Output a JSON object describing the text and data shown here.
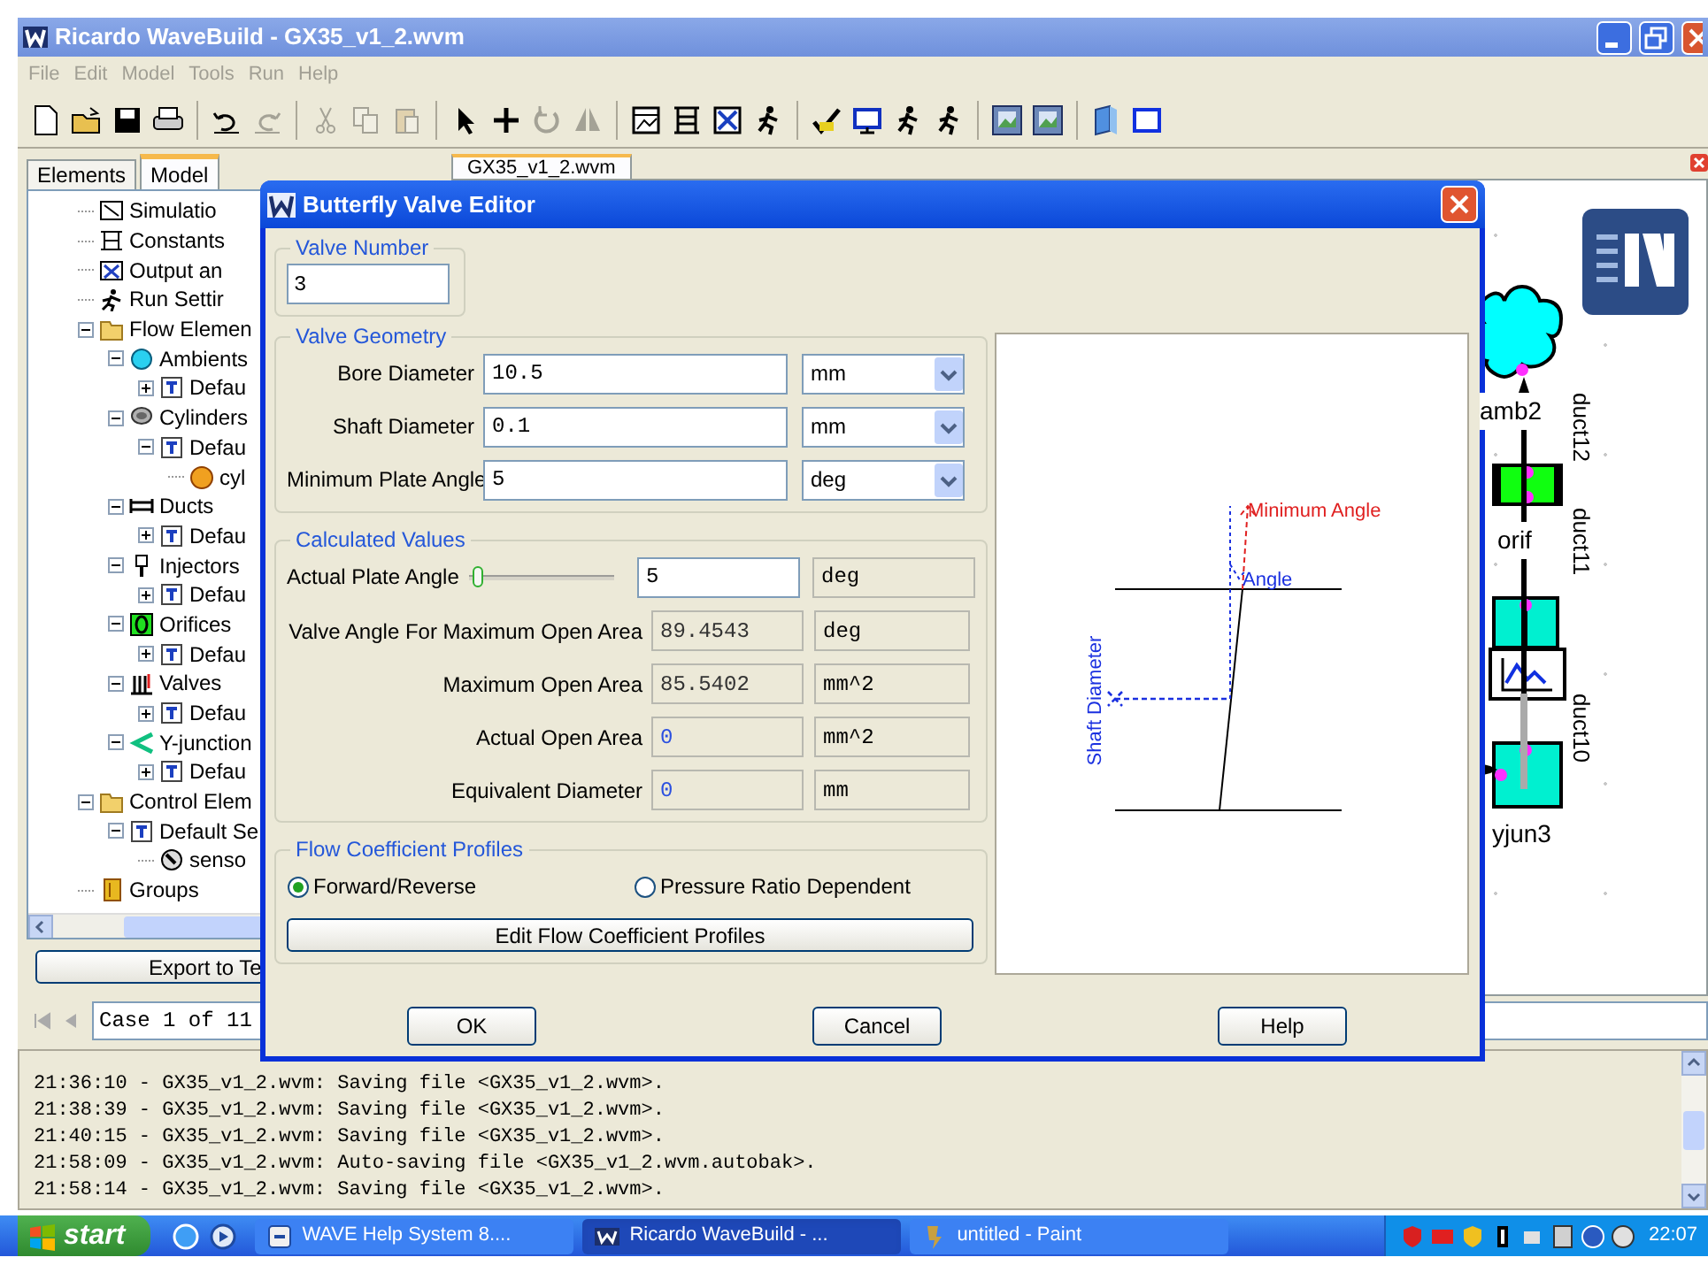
{
  "window": {
    "title": "Ricardo WaveBuild - GX35_v1_2.wvm"
  },
  "menu": [
    "File",
    "Edit",
    "Model",
    "Tools",
    "Run",
    "Help"
  ],
  "toolbar": [
    {
      "kind": "new",
      "disabled": false
    },
    {
      "kind": "open",
      "disabled": false
    },
    {
      "kind": "save",
      "disabled": false
    },
    {
      "kind": "print",
      "disabled": false
    },
    {
      "kind": "sep"
    },
    {
      "kind": "undo",
      "disabled": false
    },
    {
      "kind": "redo",
      "disabled": true
    },
    {
      "kind": "sep"
    },
    {
      "kind": "cut",
      "disabled": true
    },
    {
      "kind": "copy",
      "disabled": true
    },
    {
      "kind": "paste",
      "disabled": true
    },
    {
      "kind": "sep"
    },
    {
      "kind": "pointer",
      "disabled": false
    },
    {
      "kind": "plus",
      "disabled": false
    },
    {
      "kind": "rotate",
      "disabled": true
    },
    {
      "kind": "mirror",
      "disabled": true
    },
    {
      "kind": "sep"
    },
    {
      "kind": "window",
      "disabled": false
    },
    {
      "kind": "table",
      "disabled": false
    },
    {
      "kind": "chart",
      "disabled": false
    },
    {
      "kind": "runner",
      "disabled": false
    },
    {
      "kind": "sep"
    },
    {
      "kind": "check",
      "disabled": false
    },
    {
      "kind": "monitor",
      "disabled": false
    },
    {
      "kind": "runner",
      "disabled": false
    },
    {
      "kind": "runner",
      "disabled": false
    },
    {
      "kind": "sep"
    },
    {
      "kind": "image",
      "disabled": false
    },
    {
      "kind": "image",
      "disabled": false
    },
    {
      "kind": "sep"
    },
    {
      "kind": "book",
      "disabled": false
    },
    {
      "kind": "frame",
      "disabled": false
    }
  ],
  "left_panel": {
    "tabs": [
      {
        "label": "Elements",
        "selected": false
      },
      {
        "label": "Model",
        "selected": true
      }
    ],
    "tree": [
      {
        "label": "Simulatio",
        "kind": "sim"
      },
      {
        "label": "Constants",
        "kind": "constants"
      },
      {
        "label": "Output an",
        "kind": "output"
      },
      {
        "label": "Run Settir",
        "kind": "run"
      },
      {
        "label": "Flow Elemen",
        "kind": "folder",
        "expanded": true,
        "children": [
          {
            "label": "Ambients",
            "kind": "ambient",
            "expanded": true,
            "children": [
              {
                "label": "Defau",
                "kind": "template",
                "expanded": false
              }
            ]
          },
          {
            "label": "Cylinders",
            "kind": "cylinder",
            "expanded": true,
            "children": [
              {
                "label": "Defau",
                "kind": "template",
                "expanded": true,
                "children": [
                  {
                    "label": "cyl",
                    "kind": "dot"
                  }
                ]
              }
            ]
          },
          {
            "label": "Ducts",
            "kind": "duct",
            "expanded": true,
            "children": [
              {
                "label": "Defau",
                "kind": "template",
                "expanded": false
              }
            ]
          },
          {
            "label": "Injectors",
            "kind": "injector",
            "expanded": true,
            "children": [
              {
                "label": "Defau",
                "kind": "template",
                "expanded": false
              }
            ]
          },
          {
            "label": "Orifices",
            "kind": "orifice",
            "expanded": true,
            "children": [
              {
                "label": "Defau",
                "kind": "template",
                "expanded": false
              }
            ]
          },
          {
            "label": "Valves",
            "kind": "valve",
            "expanded": true,
            "children": [
              {
                "label": "Defau",
                "kind": "template",
                "expanded": false
              }
            ]
          },
          {
            "label": "Y-junction",
            "kind": "yjunction",
            "expanded": true,
            "children": [
              {
                "label": "Defau",
                "kind": "template",
                "expanded": false
              }
            ]
          }
        ]
      },
      {
        "label": "Control Elem",
        "kind": "folder",
        "expanded": true,
        "children": [
          {
            "label": "Default Se",
            "kind": "template",
            "expanded": true,
            "children": [
              {
                "label": "senso",
                "kind": "sensor"
              }
            ]
          }
        ]
      },
      {
        "label": "Groups",
        "kind": "groups"
      }
    ],
    "export_button": "Export to Te",
    "case_field": "Case 1 of 11"
  },
  "canvas": {
    "tab": "GX35_v1_2.wvm",
    "nodes": [
      {
        "kind": "ambient",
        "label": "amb2"
      },
      {
        "kind": "orifice",
        "label": "orif"
      },
      {
        "kind": "yjunction",
        "label": "yjun3"
      }
    ],
    "ducts": [
      "duct12",
      "duct11",
      "duct10"
    ]
  },
  "dialog": {
    "title": "Butterfly Valve Editor",
    "valve_number": {
      "legend": "Valve Number",
      "value": "3"
    },
    "geometry": {
      "legend": "Valve Geometry",
      "rows": [
        {
          "label": "Bore Diameter",
          "value": "10.5",
          "unit": "mm"
        },
        {
          "label": "Shaft Diameter",
          "value": "0.1",
          "unit": "mm"
        },
        {
          "label": "Minimum Plate Angle",
          "value": "5",
          "unit": "deg"
        }
      ]
    },
    "calculated": {
      "legend": "Calculated Values",
      "plate_angle": {
        "label": "Actual Plate Angle",
        "level": 0.03,
        "value": "5",
        "unit": "deg"
      },
      "rows": [
        {
          "label": "Valve Angle For Maximum Open Area",
          "value": "89.4543",
          "unit": "deg",
          "color": "#333333"
        },
        {
          "label": "Maximum Open Area",
          "value": "85.5402",
          "unit": "mm^2",
          "color": "#333333"
        },
        {
          "label": "Actual Open Area",
          "value": "0",
          "unit": "mm^2",
          "color": "#2b50e0"
        },
        {
          "label": "Equivalent Diameter",
          "value": "0",
          "unit": "mm",
          "color": "#2b50e0"
        }
      ]
    },
    "flow": {
      "legend": "Flow Coefficient Profiles",
      "options": [
        {
          "label": "Forward/Reverse",
          "selected": true
        },
        {
          "label": "Pressure Ratio Dependent",
          "selected": false
        }
      ],
      "button": "Edit Flow Coefficient Profiles"
    },
    "diagram": {
      "min_angle_label": "Minimum Angle",
      "angle_label": "Angle",
      "shaft_label": "Shaft Diameter"
    },
    "buttons": [
      "OK",
      "Cancel",
      "Help"
    ]
  },
  "log": [
    "21:36:10 - GX35_v1_2.wvm: Saving file <GX35_v1_2.wvm>.",
    "21:38:39 - GX35_v1_2.wvm: Saving file <GX35_v1_2.wvm>.",
    "21:40:15 - GX35_v1_2.wvm: Saving file <GX35_v1_2.wvm>.",
    "21:58:09 - GX35_v1_2.wvm: Auto-saving file <GX35_v1_2.wvm.autobak>.",
    "21:58:14 - GX35_v1_2.wvm: Saving file <GX35_v1_2.wvm>."
  ],
  "taskbar": {
    "start": "start",
    "tasks": [
      {
        "label": "WAVE Help System 8....",
        "selected": false
      },
      {
        "label": "Ricardo WaveBuild - ...",
        "selected": true
      },
      {
        "label": "untitled - Paint",
        "selected": false
      }
    ],
    "clock": "22:07"
  }
}
